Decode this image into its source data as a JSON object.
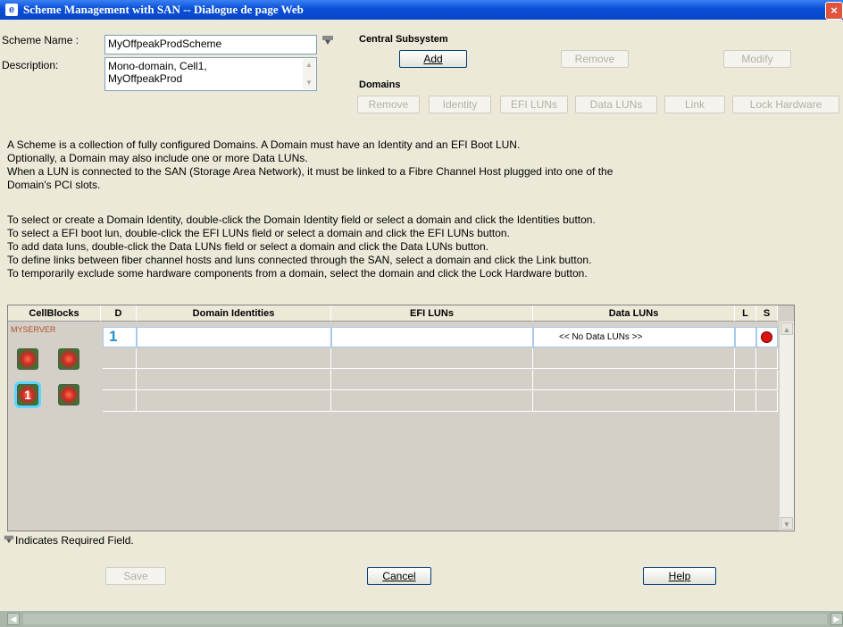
{
  "window": {
    "title": "Scheme Management with SAN -- Dialogue de page Web",
    "close": "×",
    "app_icon": "e"
  },
  "form": {
    "scheme_name_label": "Scheme Name :",
    "scheme_name_value": "MyOffpeakProdScheme",
    "description_label": "Description:",
    "description_line1": "Mono-domain, Cell1,",
    "description_line2": "MyOffpeakProd",
    "required_icon": "required-field-icon"
  },
  "central": {
    "title": "Central Subsystem",
    "add": "Add",
    "remove": "Remove",
    "modify": "Modify"
  },
  "domains": {
    "title": "Domains",
    "remove": "Remove",
    "identity": "Identity",
    "efi_luns": "EFI LUNs",
    "data_luns": "Data LUNs",
    "link": "Link",
    "lock_hardware": "Lock Hardware"
  },
  "info": {
    "p1": [
      "A Scheme is a collection of fully configured Domains. A Domain must have an Identity and an EFI Boot LUN.",
      "Optionally, a Domain may also include one or more Data LUNs.",
      "When a LUN is connected to the SAN (Storage Area Network), it must be linked to a Fibre Channel Host plugged into one of the",
      "Domain's PCI slots."
    ],
    "p2": [
      "To select or create a Domain Identity, double-click the Domain Identity field or select a domain and click the Identities button.",
      "To select a EFI boot lun, double-click the EFI LUNs field or select a domain and click the EFI LUNs button.",
      "To add data luns, double-click the Data LUNs field or select a domain and click the Data LUNs button.",
      "To define links between fiber channel hosts and luns connected through the SAN, select a domain and click the Link button.",
      "To temporarily exclude some hardware components from a domain, select the domain and click the Lock Hardware button."
    ]
  },
  "table": {
    "headers": [
      "CellBlocks",
      "D",
      "Domain Identities",
      "EFI LUNs",
      "Data LUNs",
      "L",
      "S"
    ],
    "server_name": "MYSERVER",
    "selected_cell": "1",
    "row1": {
      "d": "1",
      "data_luns": "<< No Data LUNs >>",
      "status_color": "#e01010"
    }
  },
  "footer": {
    "required_note": "Indicates Required Field.",
    "save": "Save",
    "cancel": "Cancel",
    "help": "Help"
  },
  "colors": {
    "titlebar": "#0a4fd6",
    "accent_selection": "#5ad6ff",
    "status_red": "#e01010"
  }
}
